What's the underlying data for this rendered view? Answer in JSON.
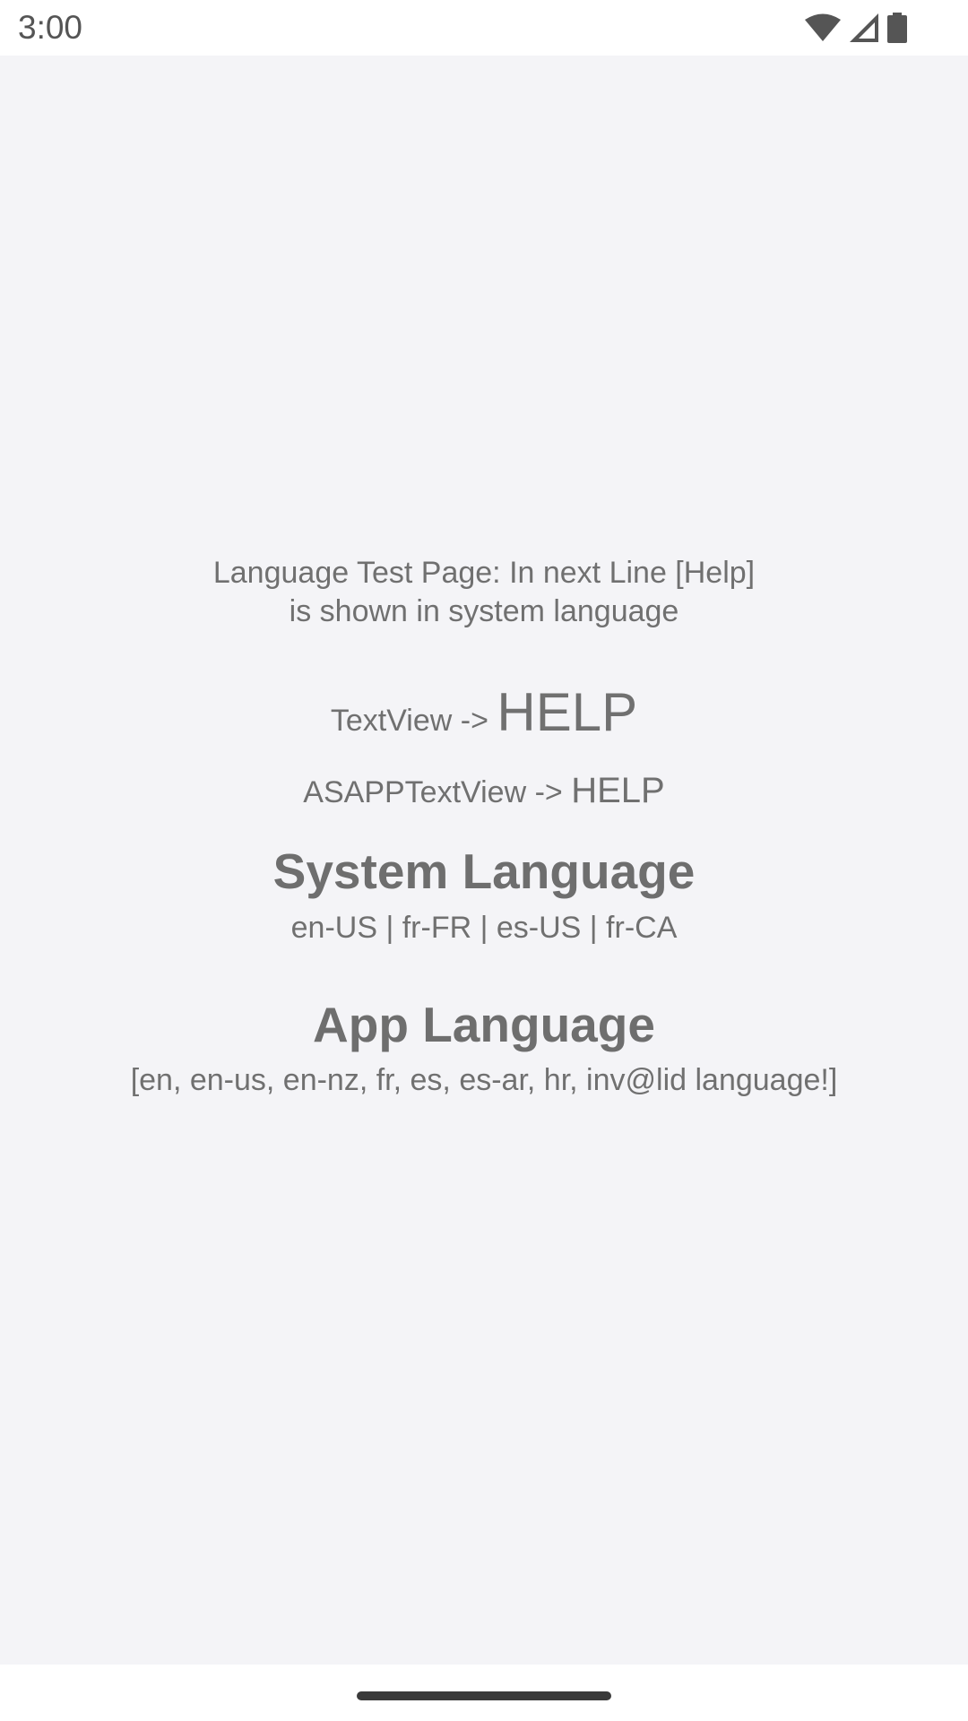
{
  "status_bar": {
    "time": "3:00",
    "icons": [
      "wifi-icon",
      "cellular-signal-icon",
      "battery-icon"
    ]
  },
  "page": {
    "intro_line1": "Language Test Page: In next Line [Help]",
    "intro_line2": "is shown in system language",
    "textview_label": "TextView -> ",
    "textview_value": "HELP",
    "asapp_label": "ASAPPTextView -> ",
    "asapp_value": "HELP",
    "system_language_title": "System Language",
    "system_language_values": "en-US | fr-FR | es-US | fr-CA",
    "app_language_title": "App Language",
    "app_language_values": "[en, en-us, en-nz, fr, es, es-ar, hr, inv@lid language!]"
  },
  "colors": {
    "background": "#f4f4f7",
    "text": "#707070"
  }
}
